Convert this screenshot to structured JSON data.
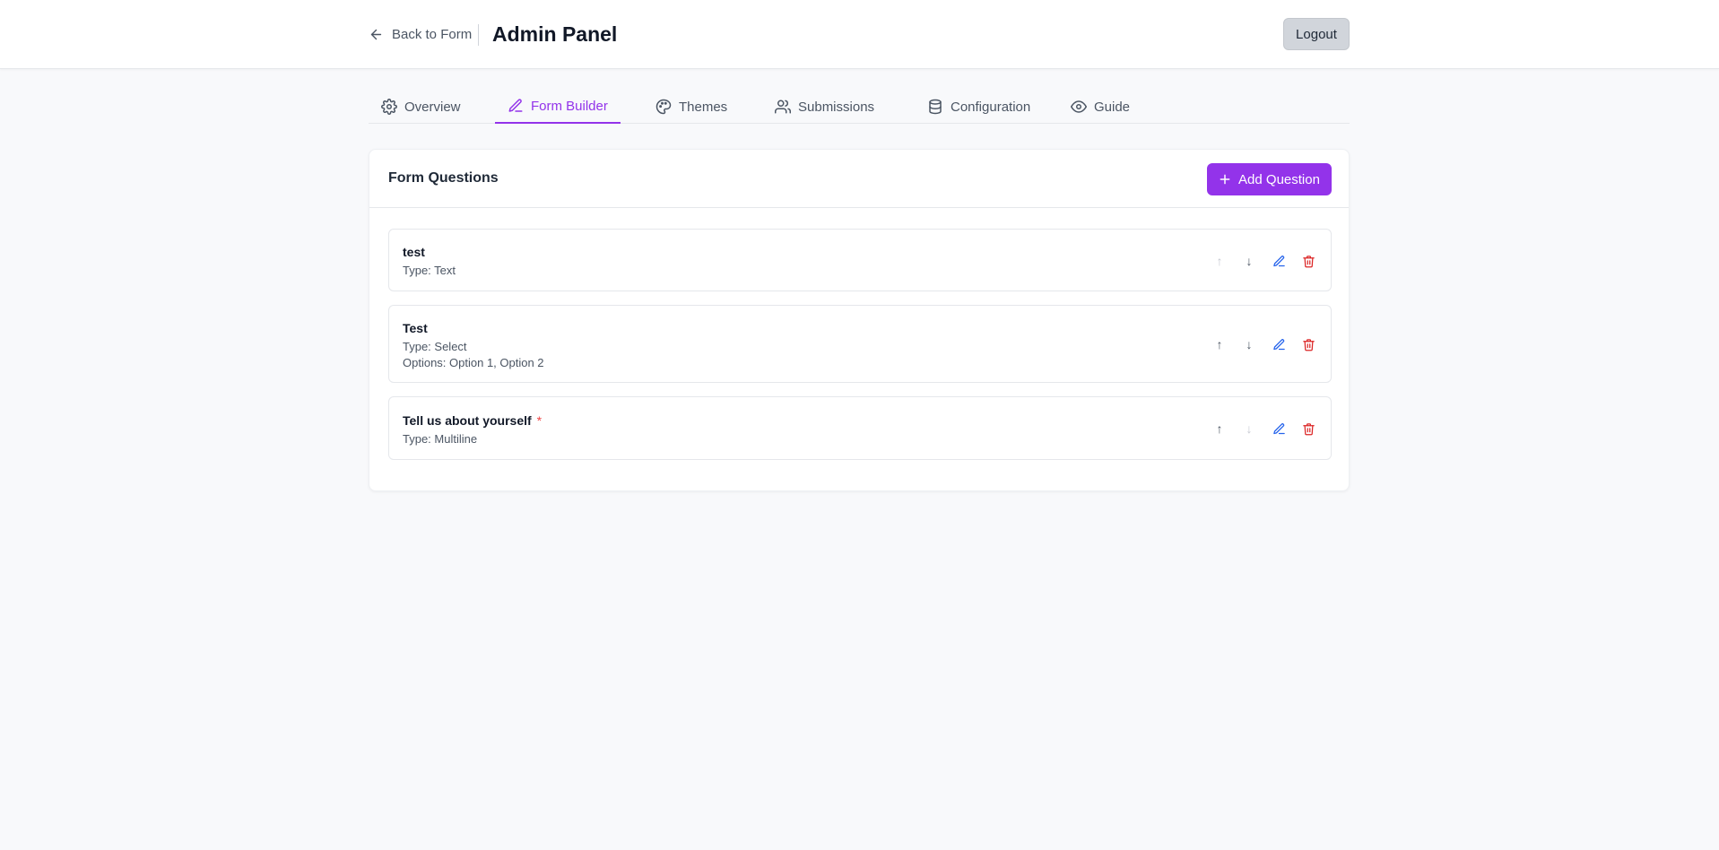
{
  "header": {
    "back_label": "Back to Form",
    "title": "Admin Panel",
    "logout_label": "Logout"
  },
  "tabs": [
    {
      "label": "Overview",
      "icon": "gear-icon"
    },
    {
      "label": "Form Builder",
      "icon": "pencil-icon",
      "active": true
    },
    {
      "label": "Themes",
      "icon": "palette-icon"
    },
    {
      "label": "Submissions",
      "icon": "users-icon"
    },
    {
      "label": "Configuration",
      "icon": "database-icon"
    },
    {
      "label": "Guide",
      "icon": "eye-icon"
    }
  ],
  "panel": {
    "title": "Form Questions",
    "add_label": "Add Question"
  },
  "questions": [
    {
      "title": "test",
      "type": "Type: Text",
      "options": "",
      "required": false,
      "up_enabled": false,
      "down_enabled": true
    },
    {
      "title": "Test",
      "type": "Type: Select",
      "options": "Options: Option 1, Option 2",
      "required": false,
      "up_enabled": true,
      "down_enabled": true
    },
    {
      "title": "Tell us about yourself",
      "type": "Type: Multiline",
      "options": "",
      "required": true,
      "required_mark": "*",
      "up_enabled": true,
      "down_enabled": false
    }
  ],
  "icons": {
    "up_arrow": "↑",
    "down_arrow": "↓"
  },
  "colors": {
    "accent": "#9333ea",
    "edit": "#2563eb",
    "delete": "#dc2626",
    "required": "#ef4444"
  }
}
